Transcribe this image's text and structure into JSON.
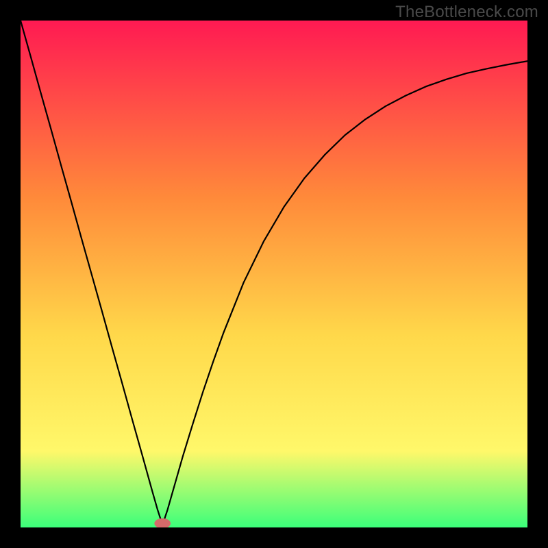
{
  "watermark": "TheBottleneck.com",
  "chart_data": {
    "type": "line",
    "title": "",
    "xlabel": "",
    "ylabel": "",
    "xlim": [
      0,
      100
    ],
    "ylim": [
      0,
      100
    ],
    "grid": false,
    "legend": false,
    "background_gradient": {
      "top": "#ff1a52",
      "mid_upper": "#ff8a3a",
      "mid": "#ffd84a",
      "mid_lower": "#fff86a",
      "bottom": "#3bff7a"
    },
    "marker": {
      "x": 28,
      "y": 0.8,
      "color": "#d46a6a",
      "rx": 1.6,
      "ry": 1.0
    },
    "series": [
      {
        "name": "curve",
        "x": [
          0,
          2,
          4,
          6,
          8,
          10,
          12,
          14,
          16,
          18,
          20,
          22,
          24,
          26,
          27,
          28,
          29,
          30,
          32,
          34,
          36,
          38,
          40,
          44,
          48,
          52,
          56,
          60,
          64,
          68,
          72,
          76,
          80,
          84,
          88,
          92,
          96,
          100
        ],
        "y": [
          100,
          92.9,
          85.7,
          78.6,
          71.4,
          64.3,
          57.1,
          50.0,
          42.9,
          35.7,
          28.6,
          21.4,
          14.3,
          7.1,
          3.6,
          0.5,
          3.5,
          7.0,
          14.0,
          20.5,
          26.8,
          32.7,
          38.3,
          48.3,
          56.5,
          63.3,
          68.9,
          73.5,
          77.4,
          80.5,
          83.1,
          85.2,
          87.0,
          88.4,
          89.6,
          90.5,
          91.3,
          92.0
        ]
      }
    ]
  }
}
